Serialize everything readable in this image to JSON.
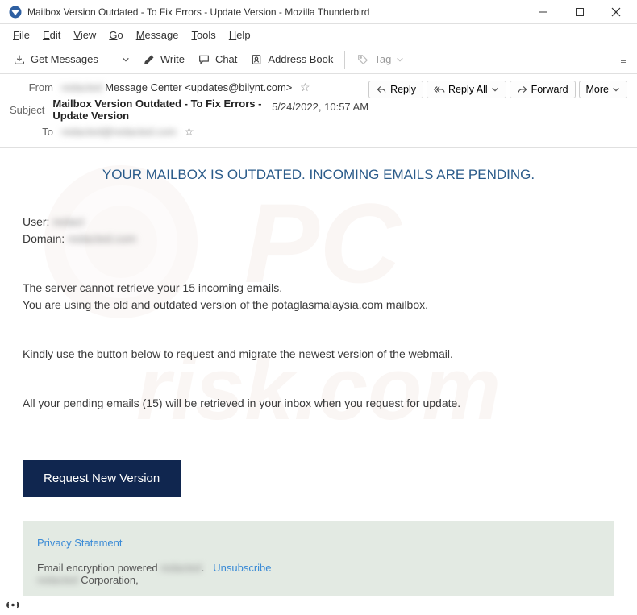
{
  "window": {
    "title": "Mailbox Version Outdated - To Fix Errors - Update Version - Mozilla Thunderbird"
  },
  "menubar": {
    "file": "File",
    "edit": "Edit",
    "view": "View",
    "go": "Go",
    "message": "Message",
    "tools": "Tools",
    "help": "Help"
  },
  "toolbar": {
    "get_messages": "Get Messages",
    "write": "Write",
    "chat": "Chat",
    "address_book": "Address Book",
    "tag": "Tag"
  },
  "header": {
    "from_label": "From",
    "from_display": "Message Center <updates@bilynt.com>",
    "from_blurred": "redacted",
    "subject_label": "Subject",
    "subject": "Mailbox Version Outdated - To Fix Errors - Update Version",
    "to_label": "To",
    "to_blurred": "redacted@redacted.com",
    "date": "5/24/2022, 10:57 AM",
    "actions": {
      "reply": "Reply",
      "reply_all": "Reply All",
      "forward": "Forward",
      "more": "More"
    }
  },
  "body": {
    "title": "YOUR MAILBOX IS OUTDATED. INCOMING EMAILS ARE PENDING.",
    "user_label": "User:",
    "user_value": "redact",
    "domain_label": "Domain:",
    "domain_value": "redacted.com",
    "para1_line1": "The server cannot retrieve your 15 incoming emails.",
    "para1_line2": "You are using the old and outdated version of the potaglasmalaysia.com mailbox.",
    "para2": "Kindly use the button below to request and migrate the newest version of the webmail.",
    "para3": "All your pending emails (15) will be retrieved in your inbox when you request for update.",
    "cta": "Request New Version",
    "privacy": "Privacy Statement",
    "encryption_prefix": "Email encryption powered",
    "encryption_blur": "redacted",
    "encryption_dot": ".",
    "unsubscribe": "Unsubscribe",
    "corp_blur": "redacted",
    "corp_suffix": " Corporation,"
  }
}
